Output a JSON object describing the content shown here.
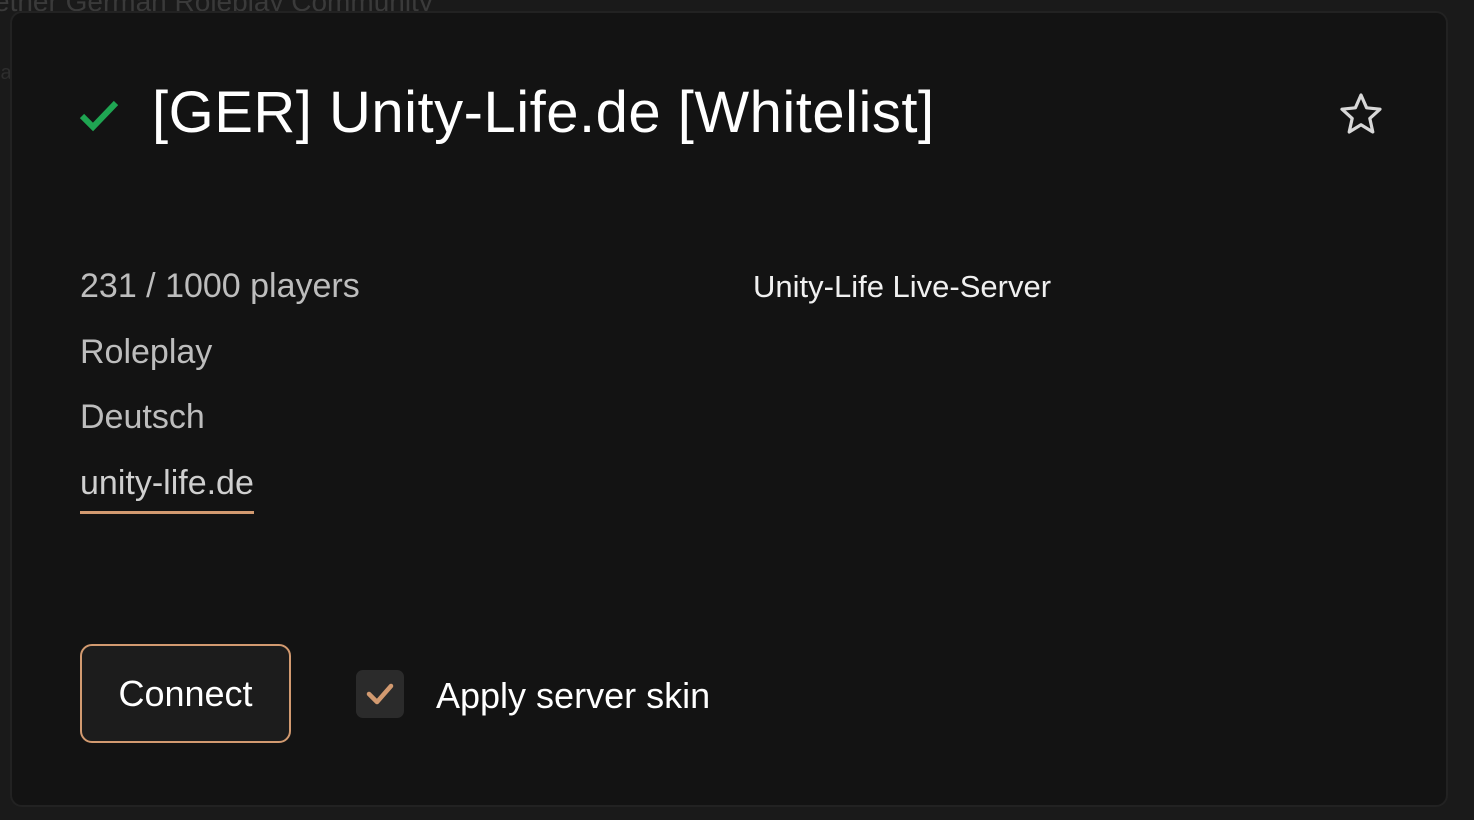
{
  "background": {
    "behind_text": "etner German Roleplay Community",
    "behind_text2": "la"
  },
  "server": {
    "title": "[GER] Unity-Life.de [Whitelist]",
    "players": "231 / 1000 players",
    "gametype": "Roleplay",
    "language": "Deutsch",
    "website": "unity-life.de",
    "hostname": "Unity-Life Live-Server",
    "verified_icon": "check-icon",
    "favorite_icon": "star-outline-icon"
  },
  "actions": {
    "connect_label": "Connect",
    "apply_skin_label": "Apply server skin",
    "apply_skin_checked": true
  },
  "colors": {
    "accent": "#d29a70",
    "verified": "#1fa552",
    "panel_bg": "#131313"
  }
}
